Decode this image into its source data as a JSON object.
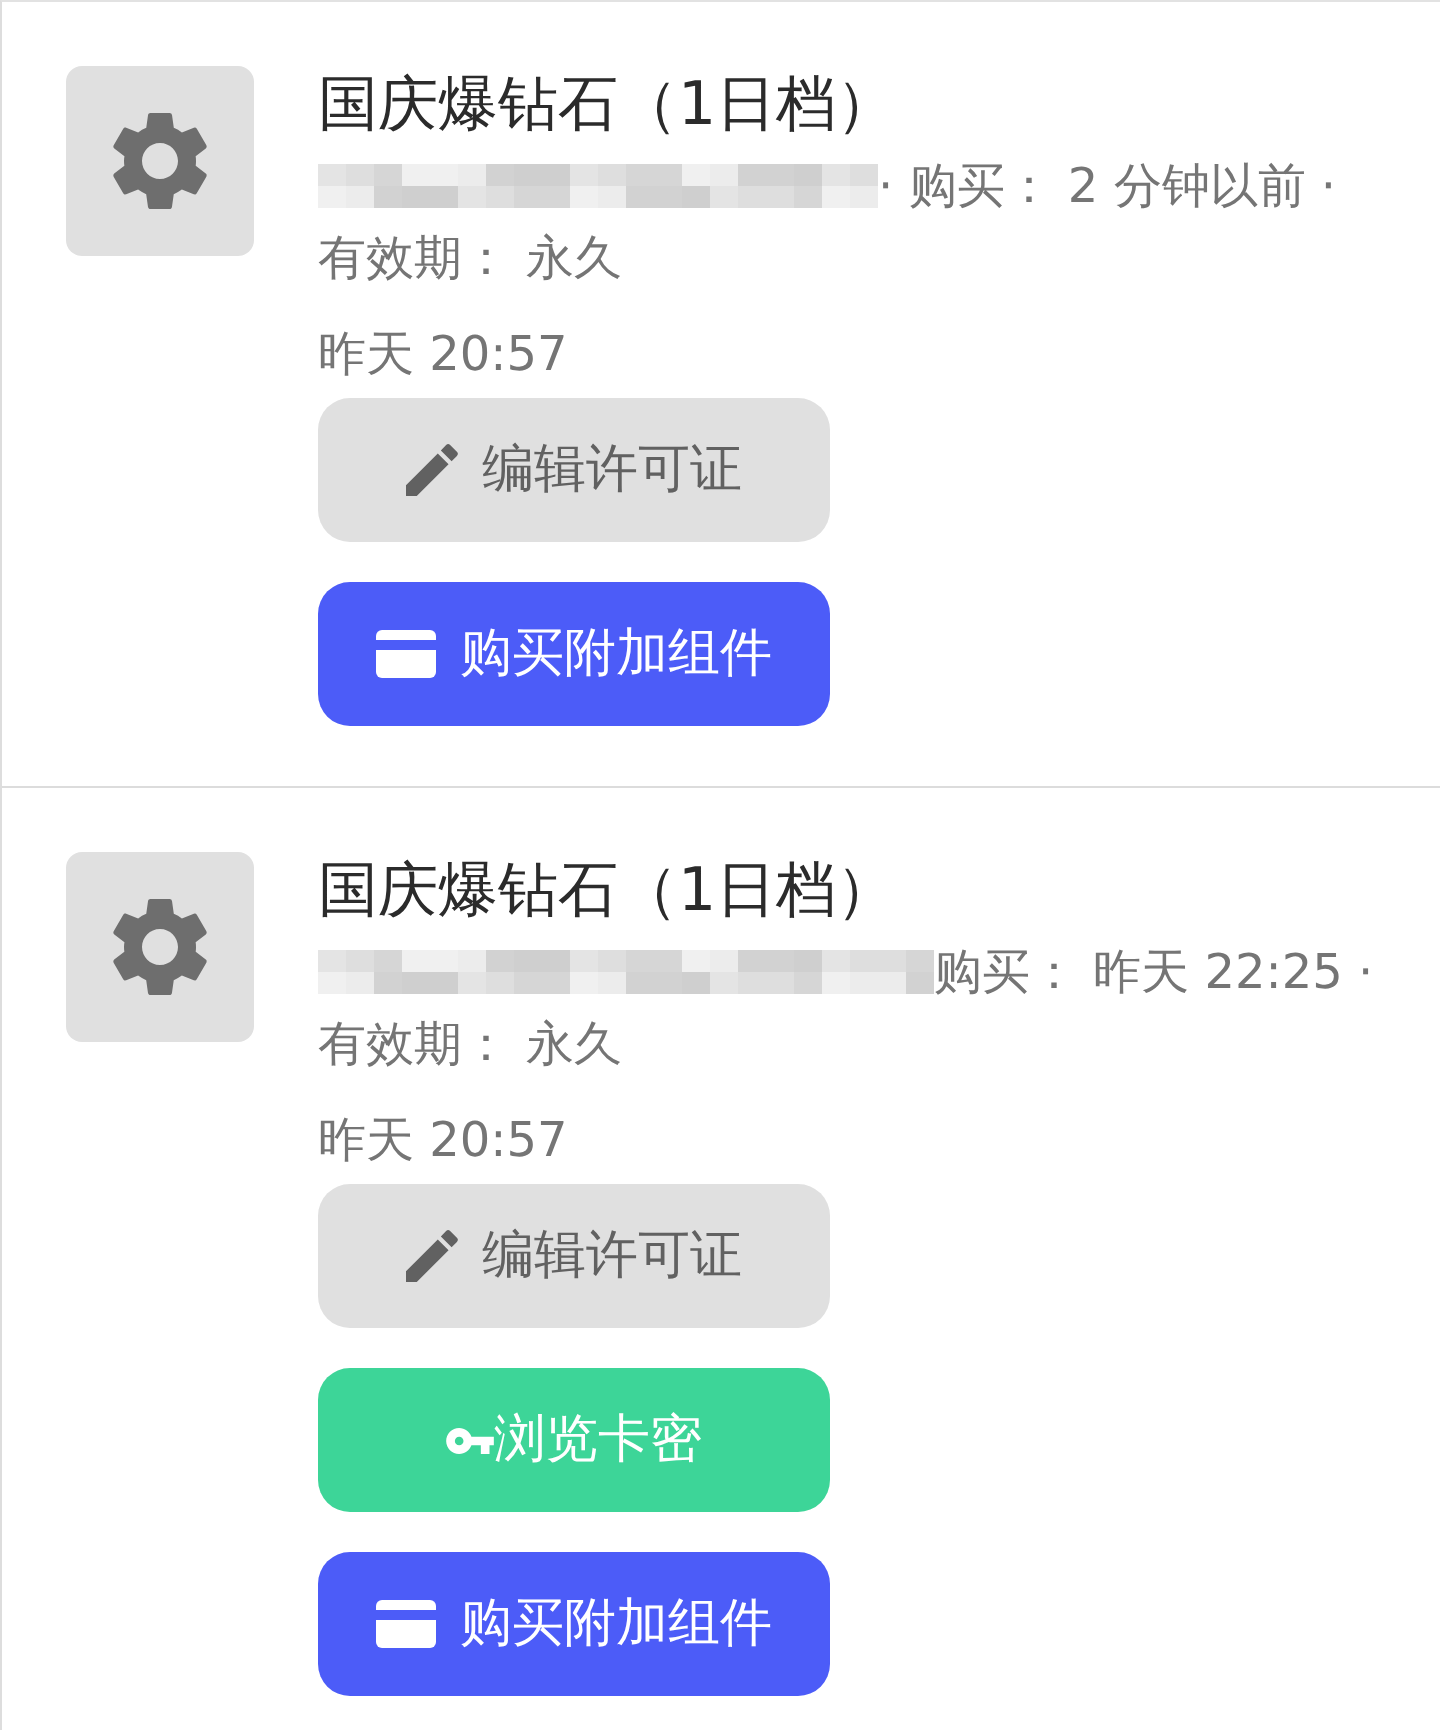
{
  "licenses": [
    {
      "title": "国庆爆钻石（1日档）",
      "purchase": "· 购买： 2 分钟以前 ·",
      "validity_label": "有效期：",
      "validity": "永久",
      "time": "昨天 20:57",
      "buttons": [
        {
          "kind": "edit",
          "label": "编辑许可证"
        },
        {
          "kind": "addon",
          "label": "购买附加组件"
        }
      ]
    },
    {
      "title": "国庆爆钻石（1日档）",
      "purchase": "购买： 昨天 22:25 ·",
      "validity_label": "有效期：",
      "validity": "永久",
      "time": "昨天 20:57",
      "buttons": [
        {
          "kind": "edit",
          "label": "编辑许可证"
        },
        {
          "kind": "keys",
          "label": "浏览卡密"
        },
        {
          "kind": "addon",
          "label": "购买附加组件"
        }
      ]
    }
  ]
}
